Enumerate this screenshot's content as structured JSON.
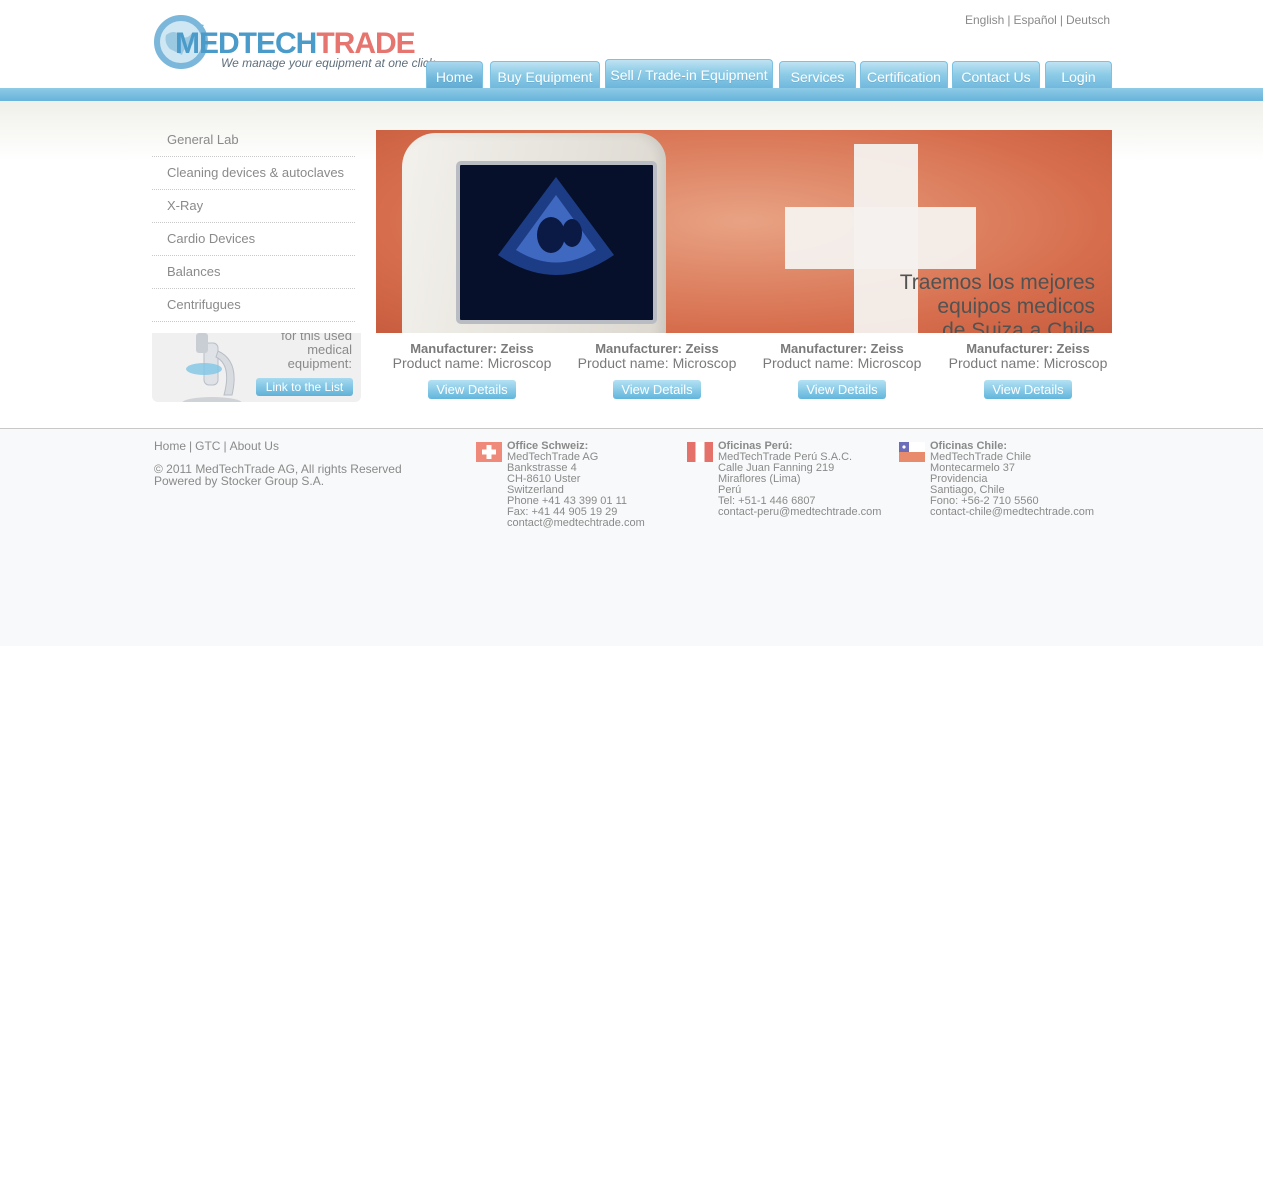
{
  "logo": {
    "brand_part1": "MEDTECH",
    "brand_part2": "TRADE",
    "tagline": "We manage your equipment at one click"
  },
  "languages": [
    "English",
    "Español",
    "Deutsch"
  ],
  "nav": [
    "Home",
    "Buy Equipment",
    "Sell / Trade-in Equipment",
    "Services",
    "Certification",
    "Contact Us",
    "Login"
  ],
  "nav_active": "Home",
  "categories": [
    "General Lab",
    "Cleaning devices & autoclaves",
    "X-Ray",
    "Cardio Devices",
    "Balances",
    "Centrifugues"
  ],
  "promo": {
    "text_line1": "for this used",
    "text_line2": "medical",
    "text_line3": "equipment:",
    "link": "Link to the List"
  },
  "banner": {
    "slogan_line1": "Traemos los mejores",
    "slogan_line2": "equipos medicos",
    "slogan_line3": "de Suiza a Chile"
  },
  "products": [
    {
      "manufacturer": "Manufacturer: Zeiss",
      "product": "Product name: Microscop",
      "button": "View Details"
    },
    {
      "manufacturer": "Manufacturer: Zeiss",
      "product": "Product name: Microscop",
      "button": "View Details"
    },
    {
      "manufacturer": "Manufacturer: Zeiss",
      "product": "Product name: Microscop",
      "button": "View Details"
    },
    {
      "manufacturer": "Manufacturer: Zeiss",
      "product": "Product name: Microscop",
      "button": "View Details"
    }
  ],
  "footer": {
    "links": [
      "Home",
      "GTC",
      "About Us"
    ],
    "copyright": "© 2011 MedTechTrade AG, All rights Reserved",
    "powered": "Powered by Stocker Group S.A.",
    "offices": [
      {
        "title": "Office Schweiz:",
        "lines": [
          "MedTechTrade AG",
          "Bankstrasse 4",
          "CH-8610 Uster",
          "Switzerland",
          "Phone +41 43 399 01 11",
          "Fax: +41 44 905 19 29",
          "contact@medtechtrade.com"
        ]
      },
      {
        "title": "Oficinas Perú:",
        "lines": [
          "MedTechTrade Perú S.A.C.",
          "Calle Juan Fanning 219",
          "Miraflores (Lima)",
          "Perú",
          "Tel: +51-1 446 6807",
          "contact-peru@medtechtrade.com"
        ]
      },
      {
        "title": "Oficinas Chile:",
        "lines": [
          "MedTechTrade Chile",
          "Montecarmelo 37",
          "Providencia",
          "Santiago, Chile",
          "Fono: +56-2 710 5560",
          "contact-chile@medtechtrade.com"
        ]
      }
    ]
  },
  "colors": {
    "brand_blue": "#4a9bc9",
    "brand_red": "#e6756f",
    "nav_blue": "#6cb6dc"
  }
}
